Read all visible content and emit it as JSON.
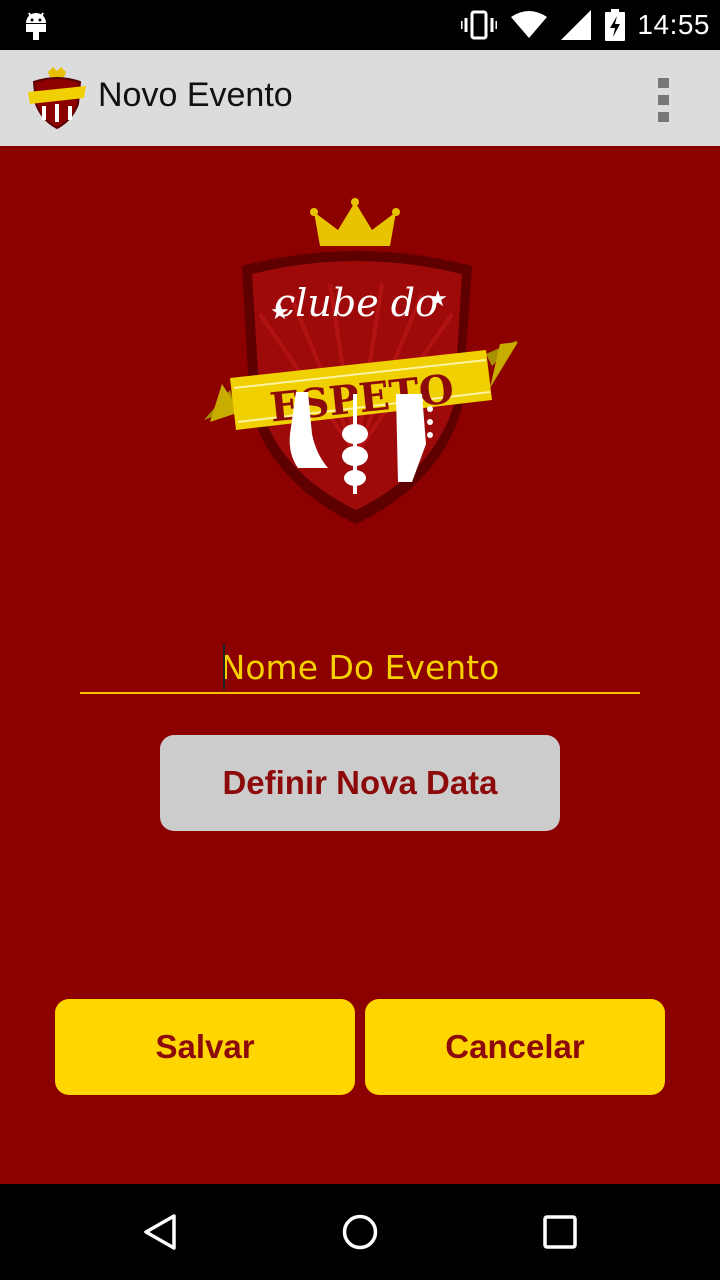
{
  "status_bar": {
    "time": "14:55",
    "icons": [
      "android-icon",
      "vibrate-icon",
      "wifi-icon",
      "signal-icon",
      "battery-charging-icon"
    ]
  },
  "action_bar": {
    "title": "Novo Evento",
    "logo_icon": "clube-do-espeto-logo",
    "menu_icon": "overflow-menu-icon"
  },
  "logo": {
    "text_top": "clube do",
    "text_banner": "ESPETO"
  },
  "form": {
    "name_placeholder": "Nome Do Evento",
    "date_button_label": "Definir Nova Data"
  },
  "actions": {
    "save_label": "Salvar",
    "cancel_label": "Cancelar"
  },
  "nav_bar": {
    "icons": [
      "back-icon",
      "home-icon",
      "recent-apps-icon"
    ]
  },
  "colors": {
    "background": "#8c0000",
    "accent_yellow": "#ffd600",
    "button_gray": "#cccccc",
    "button_text": "#8c0a0a",
    "action_bar": "#dcdcdc"
  }
}
